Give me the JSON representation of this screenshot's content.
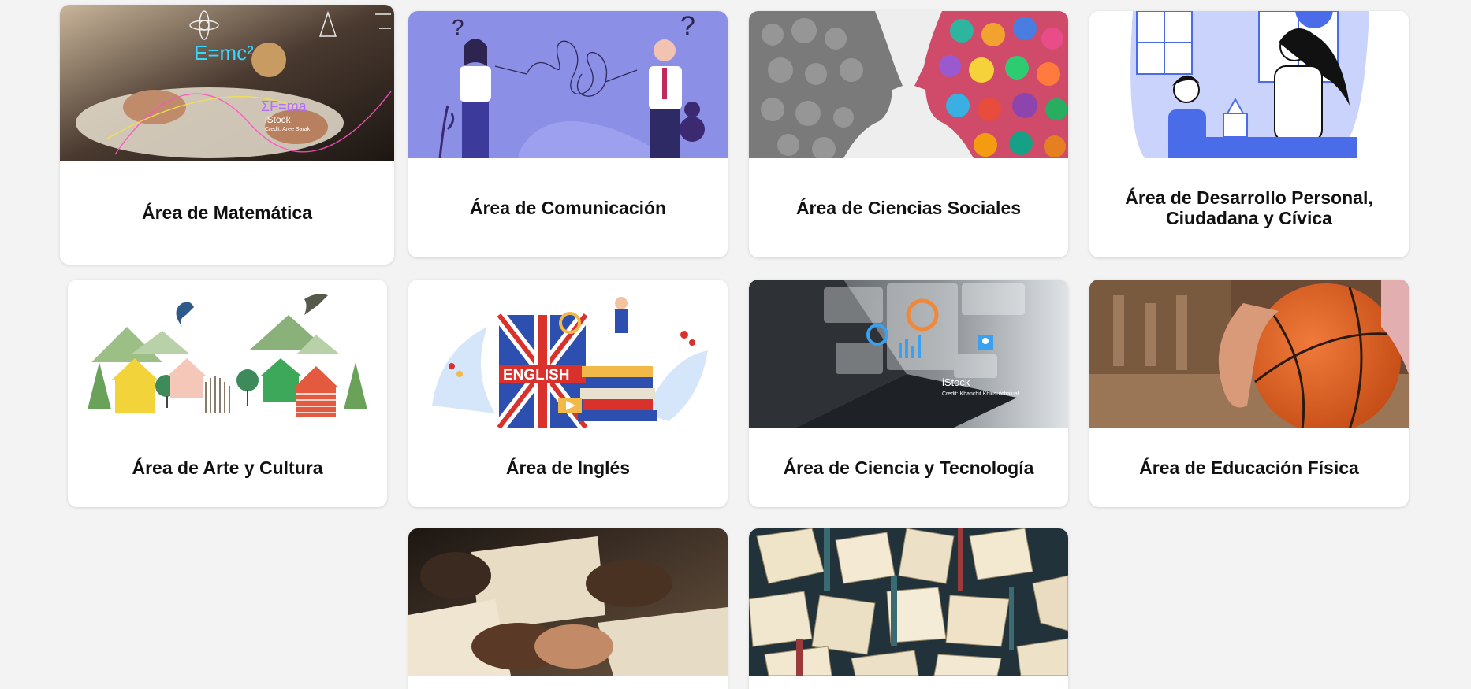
{
  "cards": [
    {
      "title": "Área de Matemática",
      "image_watermark": "iStock",
      "image_credit": "Credit: Aree Sarak",
      "image_formulas": [
        "E=mc²",
        "ΣF=ma"
      ]
    },
    {
      "title": "Área de Comunicación"
    },
    {
      "title": "Área de Ciencias Sociales"
    },
    {
      "title": "Área de Desarrollo Personal, Ciudadana y Cívica"
    },
    {
      "title": "Área de Arte y Cultura"
    },
    {
      "title": "Área de Inglés",
      "image_text": "ENGLISH"
    },
    {
      "title": "Área de Ciencia y Tecnología",
      "image_watermark": "iStock",
      "image_credit": "Credit: Khanchit Khirisutchalual"
    },
    {
      "title": "Área de Educación Física"
    },
    {
      "title": ""
    },
    {
      "title": ""
    }
  ],
  "colors": {
    "page_background": "#f3f3f3",
    "card_background": "#ffffff",
    "title_text": "#111111",
    "communication_bg": "#8b8fe6"
  }
}
